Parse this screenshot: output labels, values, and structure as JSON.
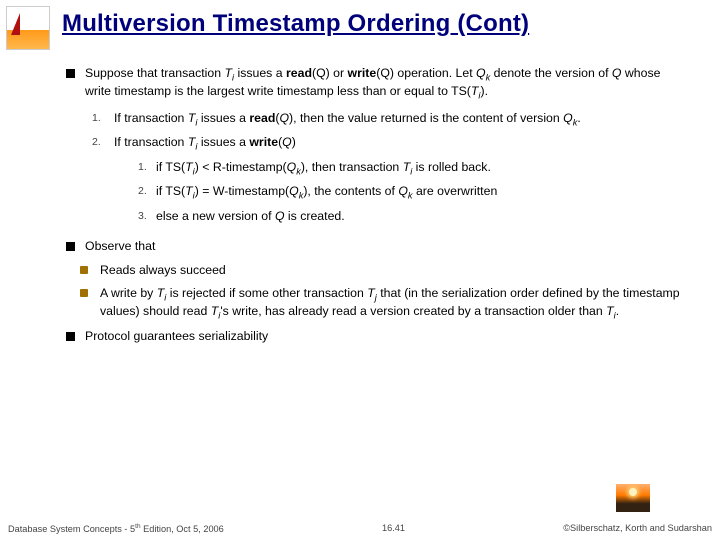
{
  "title": "Multiversion Timestamp Ordering (Cont)",
  "p1_a": "Suppose that transaction ",
  "p1_b": " issues a ",
  "p1_c": " or ",
  "p1_d": " operation.  Let ",
  "p1_e": " denote the version of ",
  "p1_f": " whose write timestamp is the largest write timestamp less than or equal to TS(",
  "p1_g": ").",
  "sym": {
    "Ti": "T",
    "i": "i",
    "Q": "Q",
    "Qk": "Q",
    "k": "k",
    "Tj": "T",
    "j": "j"
  },
  "rw": {
    "readQ": "read",
    "writeQ": "write",
    "openQ": "(Q)"
  },
  "n1": "1.",
  "n2": "2.",
  "n3": "3.",
  "li1_a": "If transaction ",
  "li1_b": " issues a ",
  "li1_c": ", then the value returned is the content of version ",
  "li1_d": ".",
  "li2_a": "If transaction ",
  "li2_b": " issues a  ",
  "sub1_a": "if TS(",
  "sub1_b": ") < R-timestamp(",
  "sub1_c": "), then transaction ",
  "sub1_d": " is rolled back.",
  "sub2_a": "if TS(",
  "sub2_b": ") = W-timestamp(",
  "sub2_c": "), the contents of ",
  "sub2_d": " are overwritten",
  "sub3": "else a new version of ",
  "sub3_b": " is created.",
  "obs": "Observe that",
  "obs1": "Reads always succeed",
  "obs2_a": "A write by ",
  "obs2_b": " is rejected if some other transaction ",
  "obs2_c": " that (in the serialization order defined by the timestamp values) should read ",
  "obs2_d": "'s write, has already read a version created by a transaction older than ",
  "obs2_e": ".",
  "proto": "Protocol guarantees serializability",
  "footer": {
    "left_a": "Database System Concepts - 5",
    "left_b": " Edition, Oct 5, 2006",
    "center": "16.41",
    "right": "©Silberschatz, Korth and Sudarshan"
  }
}
